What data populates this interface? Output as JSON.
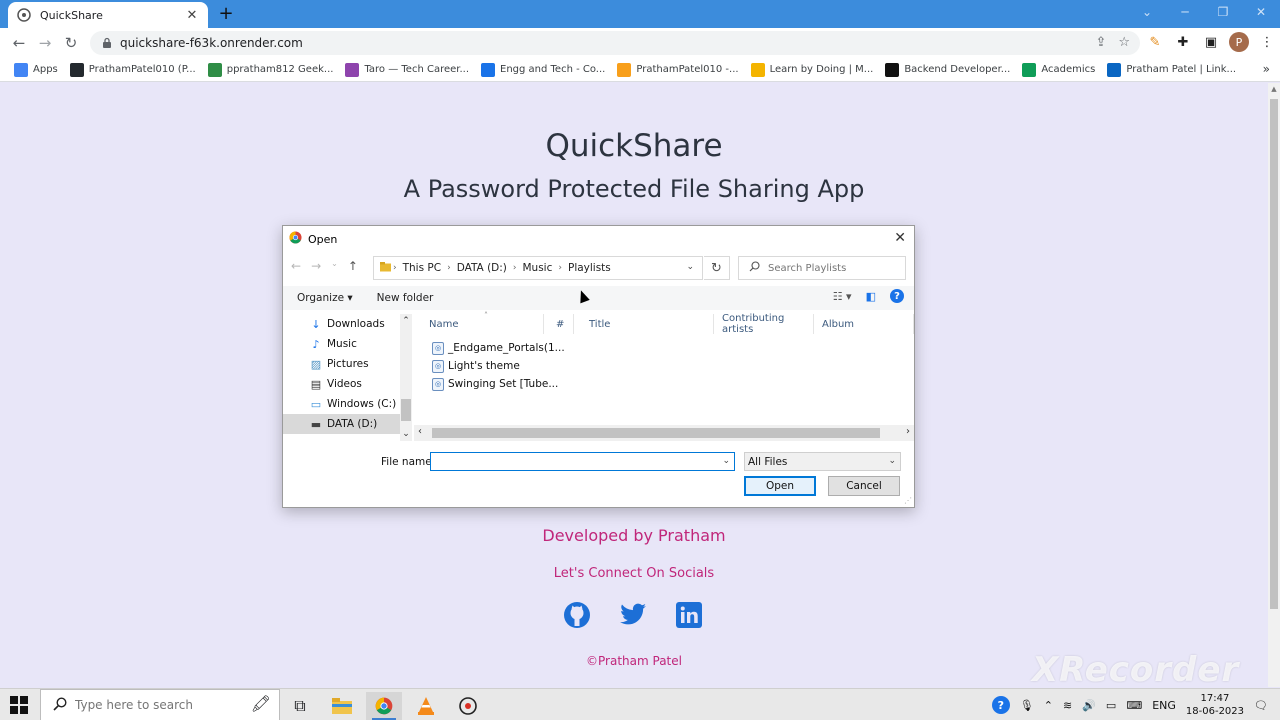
{
  "browser": {
    "tab_title": "QuickShare",
    "url": "quickshare-f63k.onrender.com",
    "profile_initial": "P"
  },
  "bookmarks": [
    {
      "label": "Apps",
      "icon": "apps-grid-icon",
      "color": "#4285f4"
    },
    {
      "label": "PrathamPatel010 (P...",
      "icon": "github-icon",
      "color": "#24292e"
    },
    {
      "label": "ppratham812 Geek...",
      "icon": "geeksforgeeks-icon",
      "color": "#2f8d46"
    },
    {
      "label": "Taro — Tech Career...",
      "icon": "taro-icon",
      "color": "#8e44ad"
    },
    {
      "label": "Engg and Tech - Co...",
      "icon": "engg-tech-icon",
      "color": "#1a73e8"
    },
    {
      "label": "PrathamPatel010 -...",
      "icon": "leetcode-icon",
      "color": "#f89f1b"
    },
    {
      "label": "Learn by Doing | M...",
      "icon": "learn-by-doing-icon",
      "color": "#f4b400"
    },
    {
      "label": "Backend Developer...",
      "icon": "roadmap-icon",
      "color": "#111111"
    },
    {
      "label": "Academics",
      "icon": "academics-icon",
      "color": "#0f9d58"
    },
    {
      "label": "Pratham Patel | Link...",
      "icon": "linkedin-icon",
      "color": "#0a66c2"
    }
  ],
  "page": {
    "title": "QuickShare",
    "subtitle": "A Password Protected File Sharing App",
    "developed_by": "Developed by Pratham",
    "connect": "Let's Connect On Socials",
    "copyright": "©Pratham Patel",
    "watermark": "XRecorder"
  },
  "dialog": {
    "title": "Open",
    "breadcrumb": [
      "This PC",
      "DATA (D:)",
      "Music",
      "Playlists"
    ],
    "search_placeholder": "Search Playlists",
    "organize": "Organize ▾",
    "new_folder": "New folder",
    "nav_items": [
      {
        "label": "Downloads",
        "icon": "downloads-icon"
      },
      {
        "label": "Music",
        "icon": "music-icon"
      },
      {
        "label": "Pictures",
        "icon": "pictures-icon"
      },
      {
        "label": "Videos",
        "icon": "videos-icon"
      },
      {
        "label": "Windows (C:)",
        "icon": "drive-c-icon"
      },
      {
        "label": "DATA (D:)",
        "icon": "drive-d-icon"
      }
    ],
    "columns": [
      "Name",
      "#",
      "Title",
      "Contributing artists",
      "Album"
    ],
    "files": [
      "_Endgame_Portals(1...",
      "Light's theme",
      "Swinging Set [Tube..."
    ],
    "file_name_label": "File name:",
    "file_name_value": "",
    "file_type": "All Files",
    "open_button": "Open",
    "cancel_button": "Cancel"
  },
  "taskbar": {
    "search_placeholder": "Type here to search",
    "language": "ENG",
    "time": "17:47",
    "date": "18-06-2023"
  },
  "colors": {
    "accent_pink": "#c0267a",
    "page_bg": "#e8e6f8",
    "tab_strip": "#3c8cdc"
  }
}
